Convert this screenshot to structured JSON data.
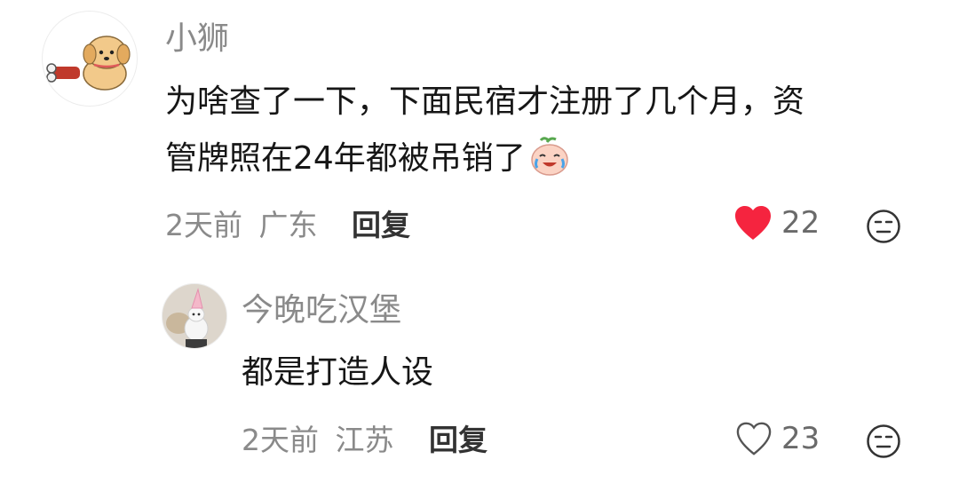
{
  "comments": [
    {
      "username": "小狮",
      "avatar_icon": "dog-with-bone-icon",
      "text_line1": "为啥查了一下，下面民宿才注册了几个月，资",
      "text_line2": "管牌照在24年都被吊销了",
      "emoji": "crying-laughing-peach-emoji",
      "time": "2天前",
      "location": "广东",
      "reply_label": "回复",
      "likes": "22",
      "liked": true,
      "like_color": "#f5243f"
    },
    {
      "username": "今晚吃汉堡",
      "avatar_icon": "bunny-with-party-hat-icon",
      "text_line1": "都是打造人设",
      "time": "2天前",
      "location": "江苏",
      "reply_label": "回复",
      "likes": "23",
      "liked": false
    }
  ]
}
